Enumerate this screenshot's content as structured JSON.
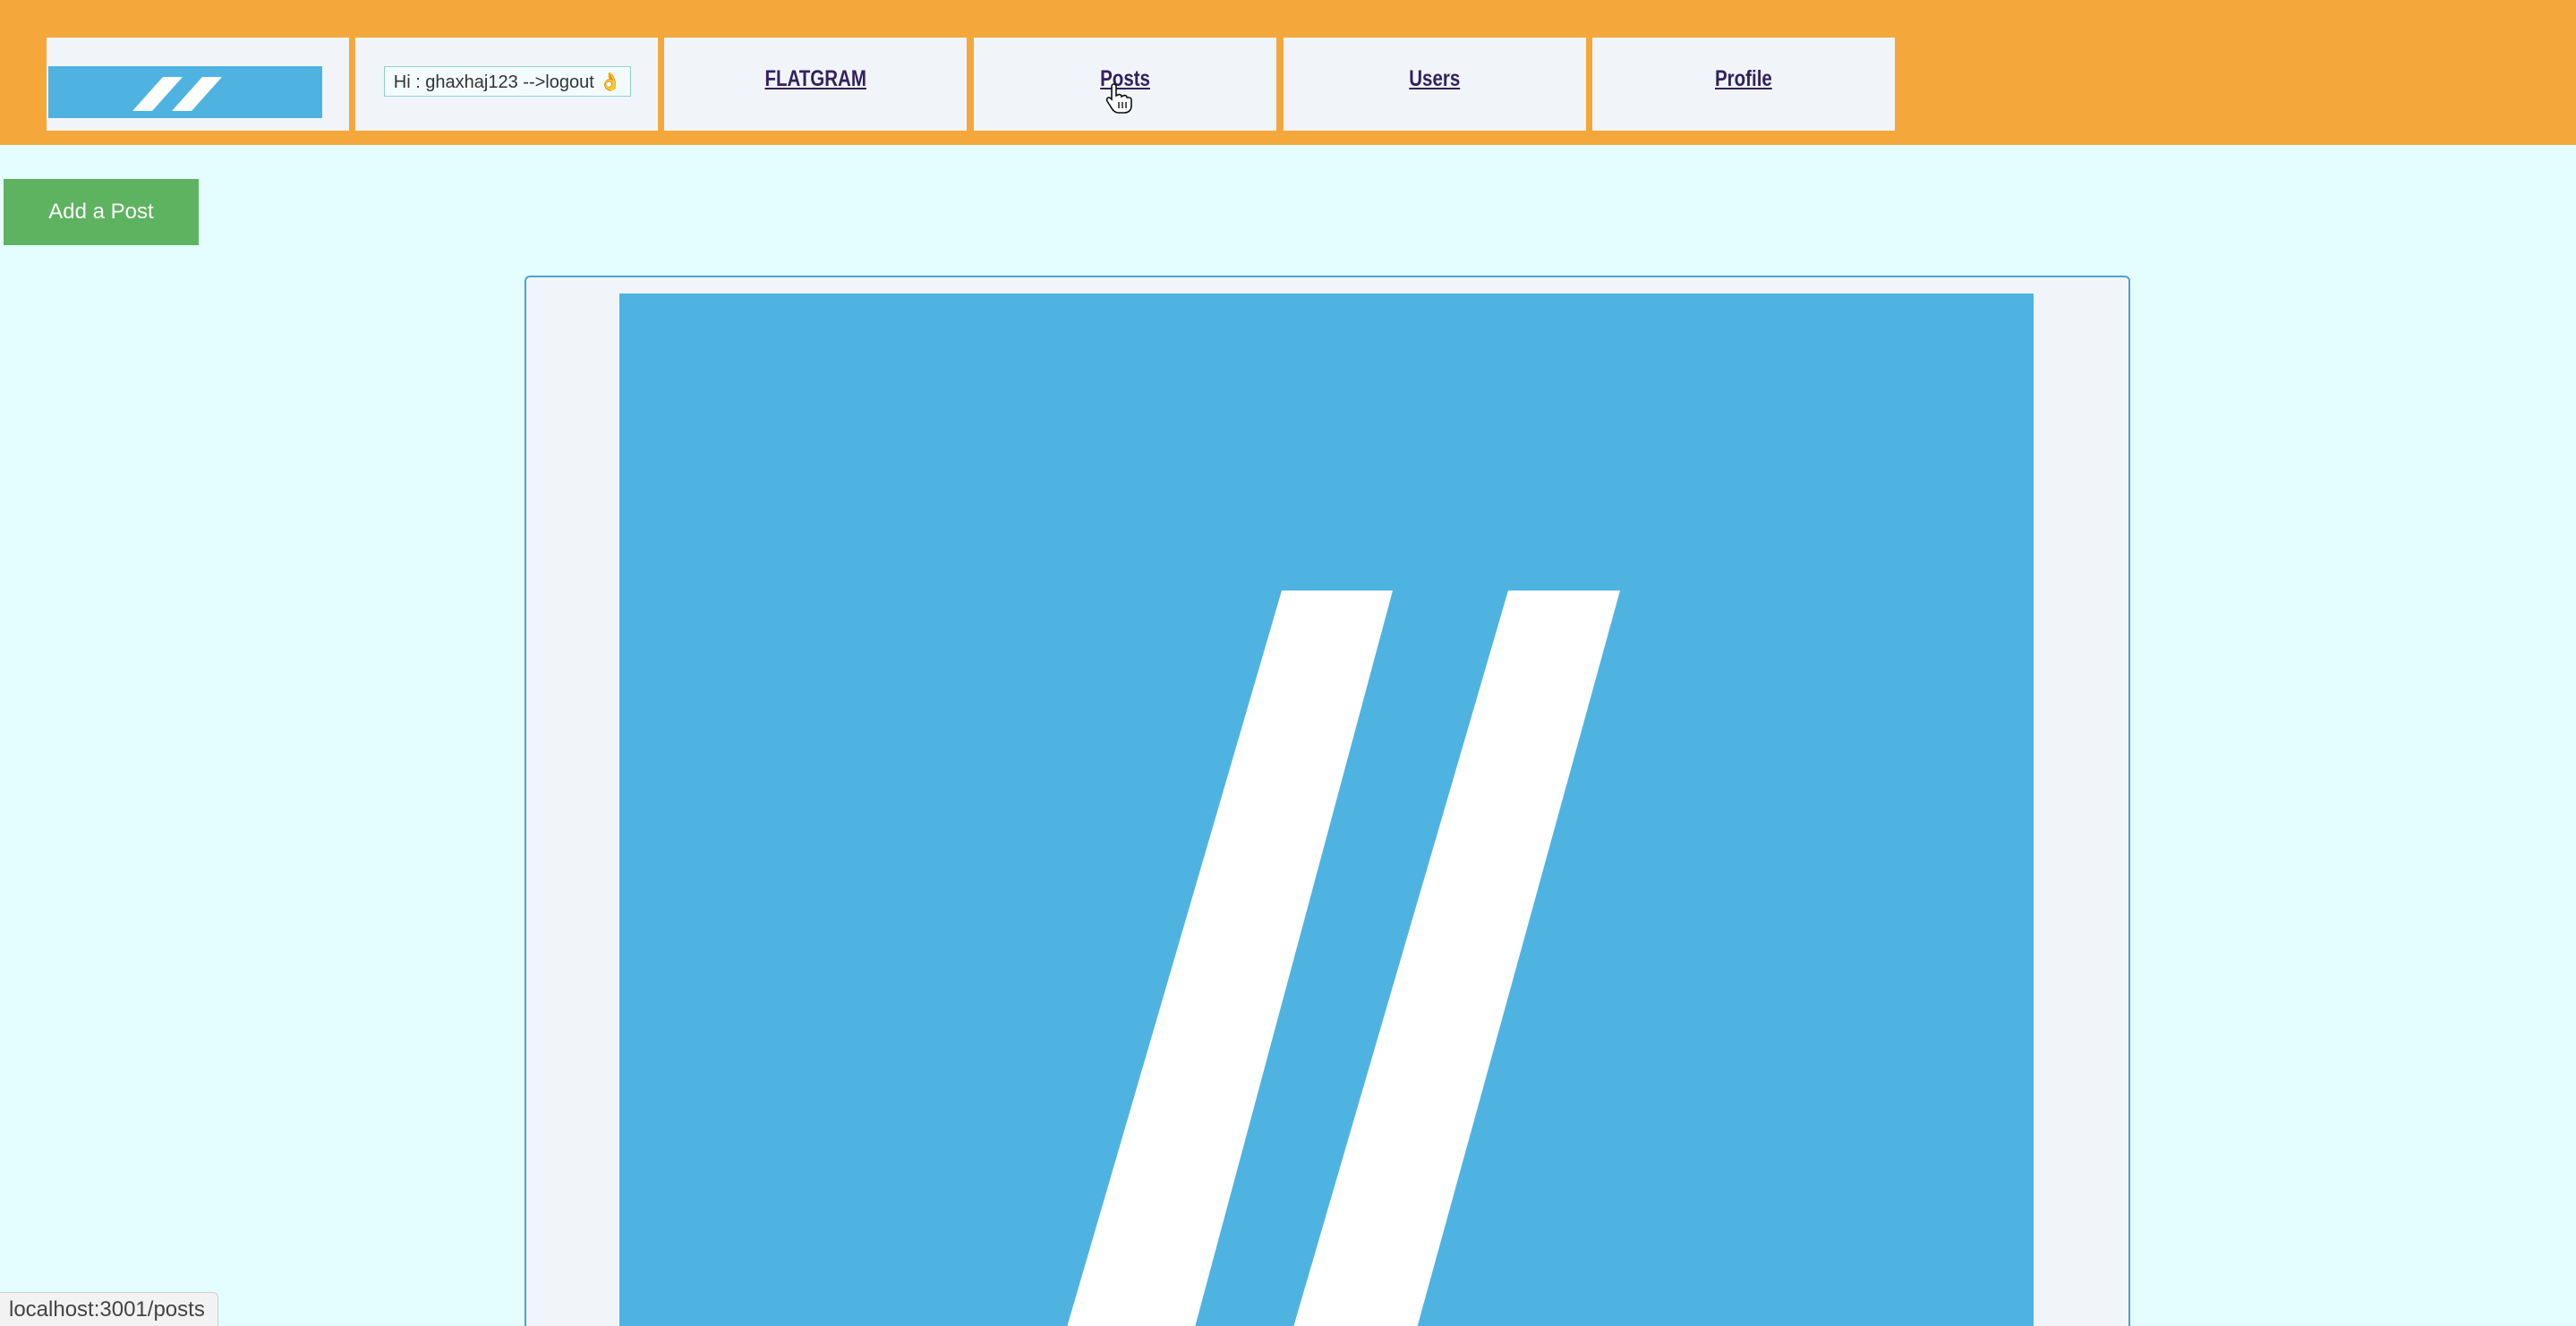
{
  "nav": {
    "logo_alt": "logo",
    "greeting": "Hi : ghaxhaj123 -->logout 👌",
    "links": [
      "FLATGRAM",
      "Posts",
      "Users",
      "Profile"
    ]
  },
  "actions": {
    "add_post_label": "Add a Post"
  },
  "status_bar": {
    "url": "localhost:3001/posts"
  },
  "colors": {
    "navbar": "#f4a83b",
    "page_background": "#e4fdff",
    "nav_cell": "#f1f5fa",
    "logo_blue": "#4fb3e2",
    "add_post_button": "#5db35f",
    "link_text": "#33215f"
  },
  "icons": {
    "logo": "double-slash-logo",
    "cursor": "hand-pointer-cursor"
  }
}
